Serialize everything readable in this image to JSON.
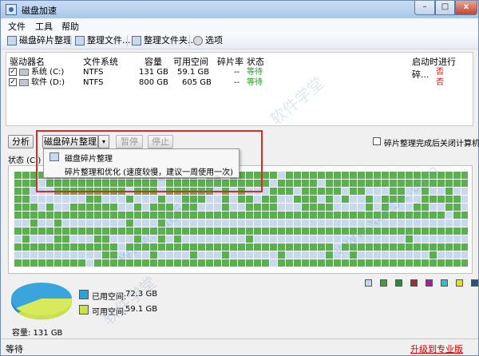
{
  "window": {
    "title": "磁盘加速",
    "min": "–",
    "max": "□",
    "close": "x"
  },
  "menu": [
    "文件",
    "工具",
    "帮助"
  ],
  "toolbar": [
    {
      "label": "磁盘碎片整理",
      "icon": "defrag-icon"
    },
    {
      "label": "整理文件...",
      "icon": "file-icon"
    },
    {
      "label": "整理文件夹...",
      "icon": "folder-icon"
    },
    {
      "label": "选项",
      "icon": "gear-icon"
    }
  ],
  "columns": [
    "驱动器名",
    "文件系统",
    "容量",
    "可用空间",
    "碎片率",
    "状态",
    "启动时进行碎..."
  ],
  "drives": [
    {
      "name": "系统 (C:)",
      "fs": "NTFS",
      "capacity": "131 GB",
      "free": "59.1 GB",
      "frag": "--",
      "status": "等待",
      "boot": "否"
    },
    {
      "name": "软件 (D:)",
      "fs": "NTFS",
      "capacity": "800 GB",
      "free": "605 GB",
      "frag": "--",
      "status": "等待",
      "boot": "否"
    }
  ],
  "buttons": {
    "analyze": "分析",
    "defrag": "磁盘碎片整理",
    "arrow": "▾",
    "pause": "暂停",
    "stop": "停止"
  },
  "shutdown_label": "碎片整理完成后关闭计算机",
  "status_tab": "状态 (C:)",
  "dropdown": [
    {
      "label": "磁盘碎片整理"
    },
    {
      "label": "碎片整理和优化 (速度较慢，建议一周使用一次)"
    }
  ],
  "legend_colors": [
    "#c5d7ee",
    "#39a23a",
    "#2b8a3d",
    "#a03030",
    "#a020a0",
    "#20c0e0",
    "#e0e020",
    "#2050a0"
  ],
  "map_colors": {
    "used": "#5ab04f",
    "free": "#c8d8ee"
  },
  "pie": {
    "used_label": "已用空间:",
    "used_value": "72.3 GB",
    "used_color": "#2aa3d9",
    "free_label": "可用空间:",
    "free_value": "59.1 GB",
    "free_color": "#cbe04a",
    "capacity": "容量: 131 GB"
  },
  "statusbar": {
    "text": "等待",
    "upgrade": "升级到专业版"
  },
  "watermark": [
    "软件学堂",
    "www.xue51.com"
  ]
}
